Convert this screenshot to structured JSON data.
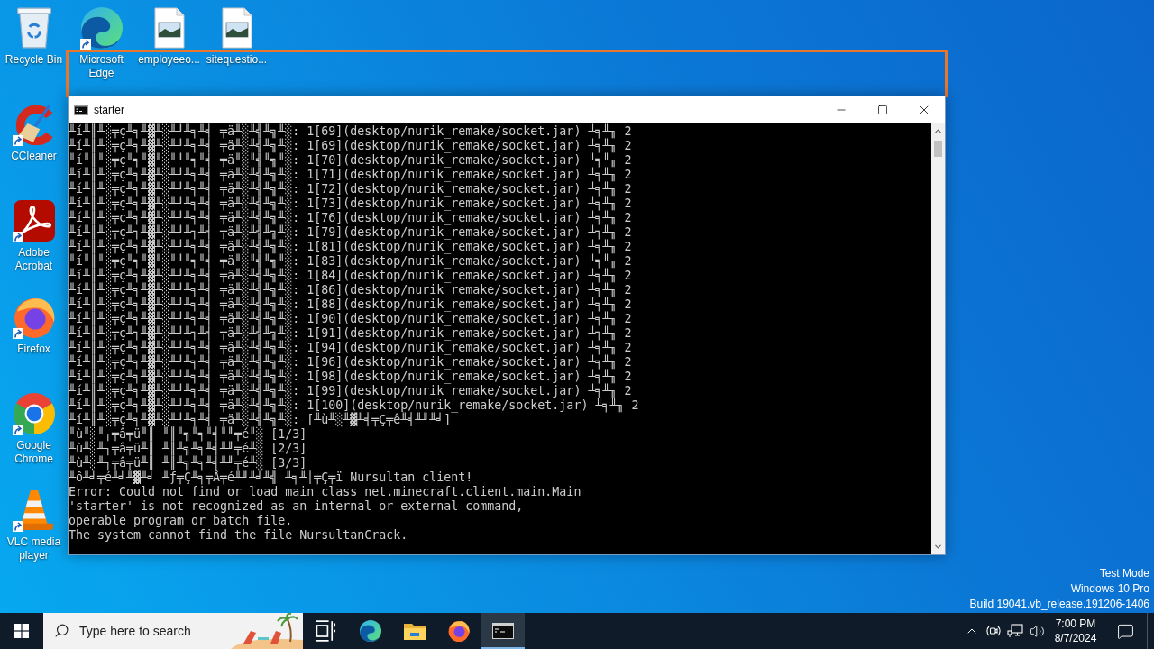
{
  "desktop": {
    "icon_row": [
      {
        "label": "Recycle Bin",
        "kind": "recycle-bin",
        "shortcut": false
      },
      {
        "label": "Microsoft Edge",
        "kind": "edge",
        "shortcut": true
      },
      {
        "label": "employeeo...",
        "kind": "image-file",
        "shortcut": false
      },
      {
        "label": "sitequestio...",
        "kind": "image-file",
        "shortcut": false
      }
    ],
    "icon_column": [
      {
        "label": "CCleaner",
        "kind": "ccleaner",
        "shortcut": true
      },
      {
        "label": "Adobe Acrobat",
        "kind": "acrobat",
        "shortcut": true
      },
      {
        "label": "Firefox",
        "kind": "firefox",
        "shortcut": true
      },
      {
        "label": "Google Chrome",
        "kind": "chrome",
        "shortcut": true
      },
      {
        "label": "VLC media player",
        "kind": "vlc",
        "shortcut": true
      }
    ],
    "system_info": [
      "Test Mode",
      "Windows 10 Pro",
      "Build 19041.vb_release.191206-1406"
    ]
  },
  "window": {
    "title": "starter",
    "lines": [
      "╨í╨║╨░╤ç╨╕╨▓╨░╨╜╨╕╨╡ ╤ä╨░╨╣╨╗╨░: 1[69](desktop/nurik_remake/socket.jar) ╨╕╨╖ 2",
      "╨í╨║╨░╤ç╨╕╨▓╨░╨╜╨╕╨╡ ╤ä╨░╨╣╨╗╨░: 1[69](desktop/nurik_remake/socket.jar) ╨╕╨╖ 2",
      "╨í╨║╨░╤ç╨╕╨▓╨░╨╜╨╕╨╡ ╤ä╨░╨╣╨╗╨░: 1[70](desktop/nurik_remake/socket.jar) ╨╕╨╖ 2",
      "╨í╨║╨░╤ç╨╕╨▓╨░╨╜╨╕╨╡ ╤ä╨░╨╣╨╗╨░: 1[71](desktop/nurik_remake/socket.jar) ╨╕╨╖ 2",
      "╨í╨║╨░╤ç╨╕╨▓╨░╨╜╨╕╨╡ ╤ä╨░╨╣╨╗╨░: 1[72](desktop/nurik_remake/socket.jar) ╨╕╨╖ 2",
      "╨í╨║╨░╤ç╨╕╨▓╨░╨╜╨╕╨╡ ╤ä╨░╨╣╨╗╨░: 1[73](desktop/nurik_remake/socket.jar) ╨╕╨╖ 2",
      "╨í╨║╨░╤ç╨╕╨▓╨░╨╜╨╕╨╡ ╤ä╨░╨╣╨╗╨░: 1[76](desktop/nurik_remake/socket.jar) ╨╕╨╖ 2",
      "╨í╨║╨░╤ç╨╕╨▓╨░╨╜╨╕╨╡ ╤ä╨░╨╣╨╗╨░: 1[79](desktop/nurik_remake/socket.jar) ╨╕╨╖ 2",
      "╨í╨║╨░╤ç╨╕╨▓╨░╨╜╨╕╨╡ ╤ä╨░╨╣╨╗╨░: 1[81](desktop/nurik_remake/socket.jar) ╨╕╨╖ 2",
      "╨í╨║╨░╤ç╨╕╨▓╨░╨╜╨╕╨╡ ╤ä╨░╨╣╨╗╨░: 1[83](desktop/nurik_remake/socket.jar) ╨╕╨╖ 2",
      "╨í╨║╨░╤ç╨╕╨▓╨░╨╜╨╕╨╡ ╤ä╨░╨╣╨╗╨░: 1[84](desktop/nurik_remake/socket.jar) ╨╕╨╖ 2",
      "╨í╨║╨░╤ç╨╕╨▓╨░╨╜╨╕╨╡ ╤ä╨░╨╣╨╗╨░: 1[86](desktop/nurik_remake/socket.jar) ╨╕╨╖ 2",
      "╨í╨║╨░╤ç╨╕╨▓╨░╨╜╨╕╨╡ ╤ä╨░╨╣╨╗╨░: 1[88](desktop/nurik_remake/socket.jar) ╨╕╨╖ 2",
      "╨í╨║╨░╤ç╨╕╨▓╨░╨╜╨╕╨╡ ╤ä╨░╨╣╨╗╨░: 1[90](desktop/nurik_remake/socket.jar) ╨╕╨╖ 2",
      "╨í╨║╨░╤ç╨╕╨▓╨░╨╜╨╕╨╡ ╤ä╨░╨╣╨╗╨░: 1[91](desktop/nurik_remake/socket.jar) ╨╕╨╖ 2",
      "╨í╨║╨░╤ç╨╕╨▓╨░╨╜╨╕╨╡ ╤ä╨░╨╣╨╗╨░: 1[94](desktop/nurik_remake/socket.jar) ╨╕╨╖ 2",
      "╨í╨║╨░╤ç╨╕╨▓╨░╨╜╨╕╨╡ ╤ä╨░╨╣╨╗╨░: 1[96](desktop/nurik_remake/socket.jar) ╨╕╨╖ 2",
      "╨í╨║╨░╤ç╨╕╨▓╨░╨╜╨╕╨╡ ╤ä╨░╨╣╨╗╨░: 1[98](desktop/nurik_remake/socket.jar) ╨╕╨╖ 2",
      "╨í╨║╨░╤ç╨╕╨▓╨░╨╜╨╕╨╡ ╤ä╨░╨╣╨╗╨░: 1[99](desktop/nurik_remake/socket.jar) ╨╕╨╖ 2",
      "╨í╨║╨░╤ç╨╕╨▓╨░╨╜╨╕╨╡ ╤ä╨░╨╣╨╗╨░: 1[100](desktop/nurik_remake/socket.jar) ╨╕╨╖ 2",
      "╨í╨║╨░╤ç╨╕╨▓╨░╨╜╨╕╨╡ ╤ä╨░╨╣╨╗╨░: [╨ù╨░╨▓╨╡╤Ç╤ê╨╡╨╜╨╛]",
      "╨ù╨░╨┐╤â╤ü╨║ ╨║╨╗╨╕╨╡╨╜╤é╨░ [1/3]",
      "╨ù╨░╨┐╤â╤ü╨║ ╨║╨╗╨╕╨╡╨╜╤é╨░ [2/3]",
      "╨ù╨░╨┐╤â╤ü╨║ ╨║╨╗╨╕╨╡╨╜╤é╨░ [3/3]",
      "╨ô╨╛╤é╨╛╨▓╨╛ ╨ƒ╤Ç╨╕╤Å╤é╨╜╨╛╨╣ ╨╕╨│╤Ç╤ï Nursultan client!",
      "Error: Could not find or load main class net.minecraft.client.main.Main",
      "'starter' is not recognized as an internal or external command,",
      "operable program or batch file.",
      "The system cannot find the file NursultanCrack."
    ]
  },
  "taskbar": {
    "search": {
      "placeholder": "Type here to search"
    },
    "apps": [
      {
        "kind": "task-view",
        "active": false
      },
      {
        "kind": "edge",
        "active": false
      },
      {
        "kind": "file-explorer",
        "active": false
      },
      {
        "kind": "firefox",
        "active": false
      },
      {
        "kind": "terminal",
        "active": true
      }
    ],
    "clock": {
      "time": "7:00 PM",
      "date": "8/7/2024"
    }
  }
}
